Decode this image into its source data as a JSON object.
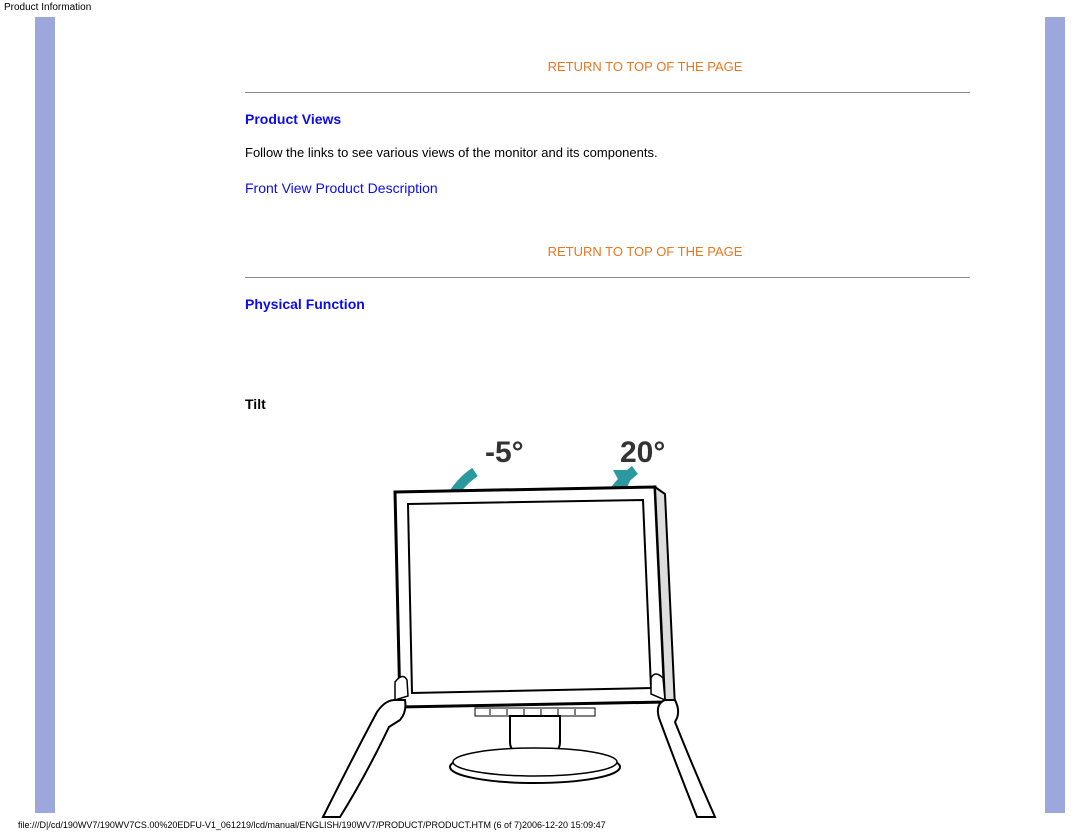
{
  "header": {
    "title": "Product Information"
  },
  "links": {
    "return_top": "RETURN TO TOP OF THE PAGE",
    "front_view": "Front View Product Description"
  },
  "sections": {
    "product_views": {
      "heading": "Product Views",
      "text": "Follow the links to see various views of the monitor and its components."
    },
    "physical_function": {
      "heading": "Physical Function",
      "tilt_label": "Tilt"
    }
  },
  "tilt_diagram": {
    "back_label": "-5°",
    "forward_label": "20°"
  },
  "footer": {
    "path": "file:///D|/cd/190WV7/190WV7CS.00%20EDFU-V1_061219/lcd/manual/ENGLISH/190WV7/PRODUCT/PRODUCT.HTM (6 of 7)2006-12-20 15:09:47"
  }
}
